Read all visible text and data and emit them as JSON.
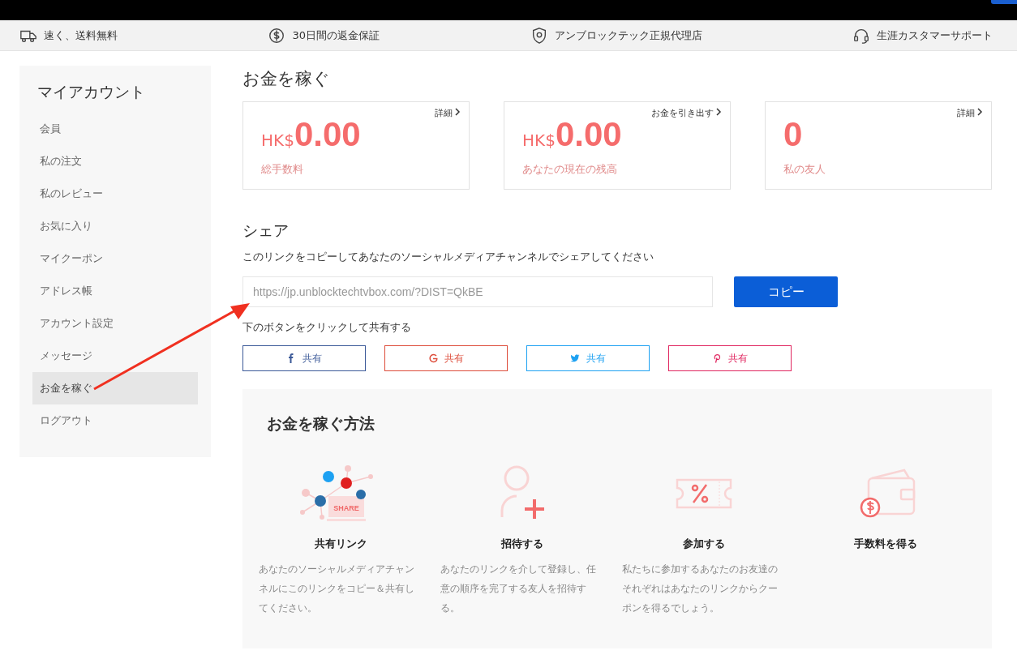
{
  "benefits_bar": [
    {
      "kind": "truck",
      "text": "速く、送料無料"
    },
    {
      "kind": "money",
      "text": "30日間の返金保証"
    },
    {
      "kind": "shield",
      "text": "アンブロックテック正規代理店"
    },
    {
      "kind": "headset",
      "text": "生涯カスタマーサポート"
    }
  ],
  "sidebar": {
    "title": "マイアカウント",
    "items": [
      {
        "label": "会員",
        "selected": false
      },
      {
        "label": "私の注文",
        "selected": false
      },
      {
        "label": "私のレビュー",
        "selected": false
      },
      {
        "label": "お気に入り",
        "selected": false
      },
      {
        "label": "マイクーポン",
        "selected": false
      },
      {
        "label": "アドレス帳",
        "selected": false
      },
      {
        "label": "アカウント設定",
        "selected": false
      },
      {
        "label": "メッセージ",
        "selected": false
      },
      {
        "label": "お金を稼ぐ",
        "selected": true
      },
      {
        "label": "ログアウト",
        "selected": false
      }
    ]
  },
  "page_title": "お金を稼ぐ",
  "stat_cards": [
    {
      "link": "詳細",
      "currency": "HK$",
      "value": "0.00",
      "label": "総手数料"
    },
    {
      "link": "お金を引き出す",
      "currency": "HK$",
      "value": "0.00",
      "label": "あなたの現在の残高"
    },
    {
      "link": "詳細",
      "value": "0",
      "label": "私の友人"
    }
  ],
  "share": {
    "title": "シェア",
    "instruction": "このリンクをコピーしてあなたのソーシャルメディアチャンネルでシェアしてください",
    "link_field": {
      "placeholder": "https://jp.unblocktechtvbox.com/?DIST=QkBE"
    },
    "copy_button": "コピー",
    "buttons_hint": "下のボタンをクリックして共有する",
    "buttons": [
      {
        "kind": "facebook",
        "label": "共有",
        "color": "#3b5998"
      },
      {
        "kind": "google",
        "label": "共有",
        "color": "#dd4b39"
      },
      {
        "kind": "twitter",
        "label": "共有",
        "color": "#1da1f2"
      },
      {
        "kind": "pinterest",
        "label": "共有",
        "color": "#e0245e"
      }
    ]
  },
  "how_to": {
    "title": "お金を稼ぐ方法",
    "illustration_text": "SHARE",
    "steps": [
      {
        "kind": "share",
        "title": "共有リンク",
        "text": "あなたのソーシャルメディアチャンネルにこのリンクをコピー＆共有してください。"
      },
      {
        "kind": "invite",
        "title": "招待する",
        "text": "あなたのリンクを介して登録し、任意の順序を完了する友人を招待する。"
      },
      {
        "kind": "coupon",
        "title": "参加する",
        "text": "私たちに参加するあなたのお友達のそれぞれはあなたのリンクからクーポンを得るでしょう。"
      },
      {
        "kind": "wallet",
        "title": "手数料を得る"
      }
    ]
  }
}
